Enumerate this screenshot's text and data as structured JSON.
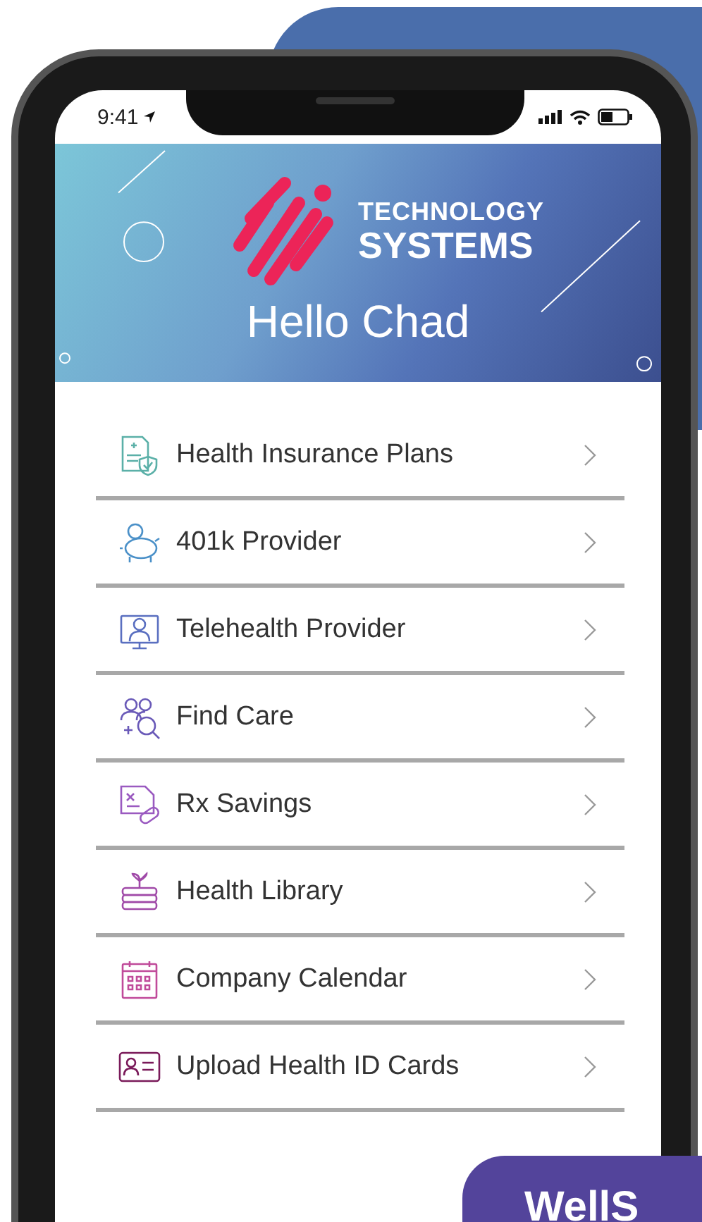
{
  "status_bar": {
    "time": "9:41"
  },
  "banner": {
    "brand_top": "TECHNOLOGY",
    "brand_bottom": "SYSTEMS",
    "greeting": "Hello Chad"
  },
  "menu": [
    {
      "label": "Health Insurance Plans",
      "kind": "insurance",
      "color": "#5bb0a8"
    },
    {
      "label": "401k Provider",
      "kind": "savings",
      "color": "#4a90c8"
    },
    {
      "label": "Telehealth Provider",
      "kind": "telehealth",
      "color": "#5a6fc0"
    },
    {
      "label": "Find Care",
      "kind": "care",
      "color": "#6a5ab8"
    },
    {
      "label": "Rx Savings",
      "kind": "rx",
      "color": "#9a5ac0"
    },
    {
      "label": "Health Library",
      "kind": "library",
      "color": "#a04aa8"
    },
    {
      "label": "Company Calendar",
      "kind": "calendar",
      "color": "#c04a9a"
    },
    {
      "label": "Upload Health ID Cards",
      "kind": "idcard",
      "color": "#7a1a5a"
    }
  ],
  "badge": {
    "text": "WellS"
  }
}
